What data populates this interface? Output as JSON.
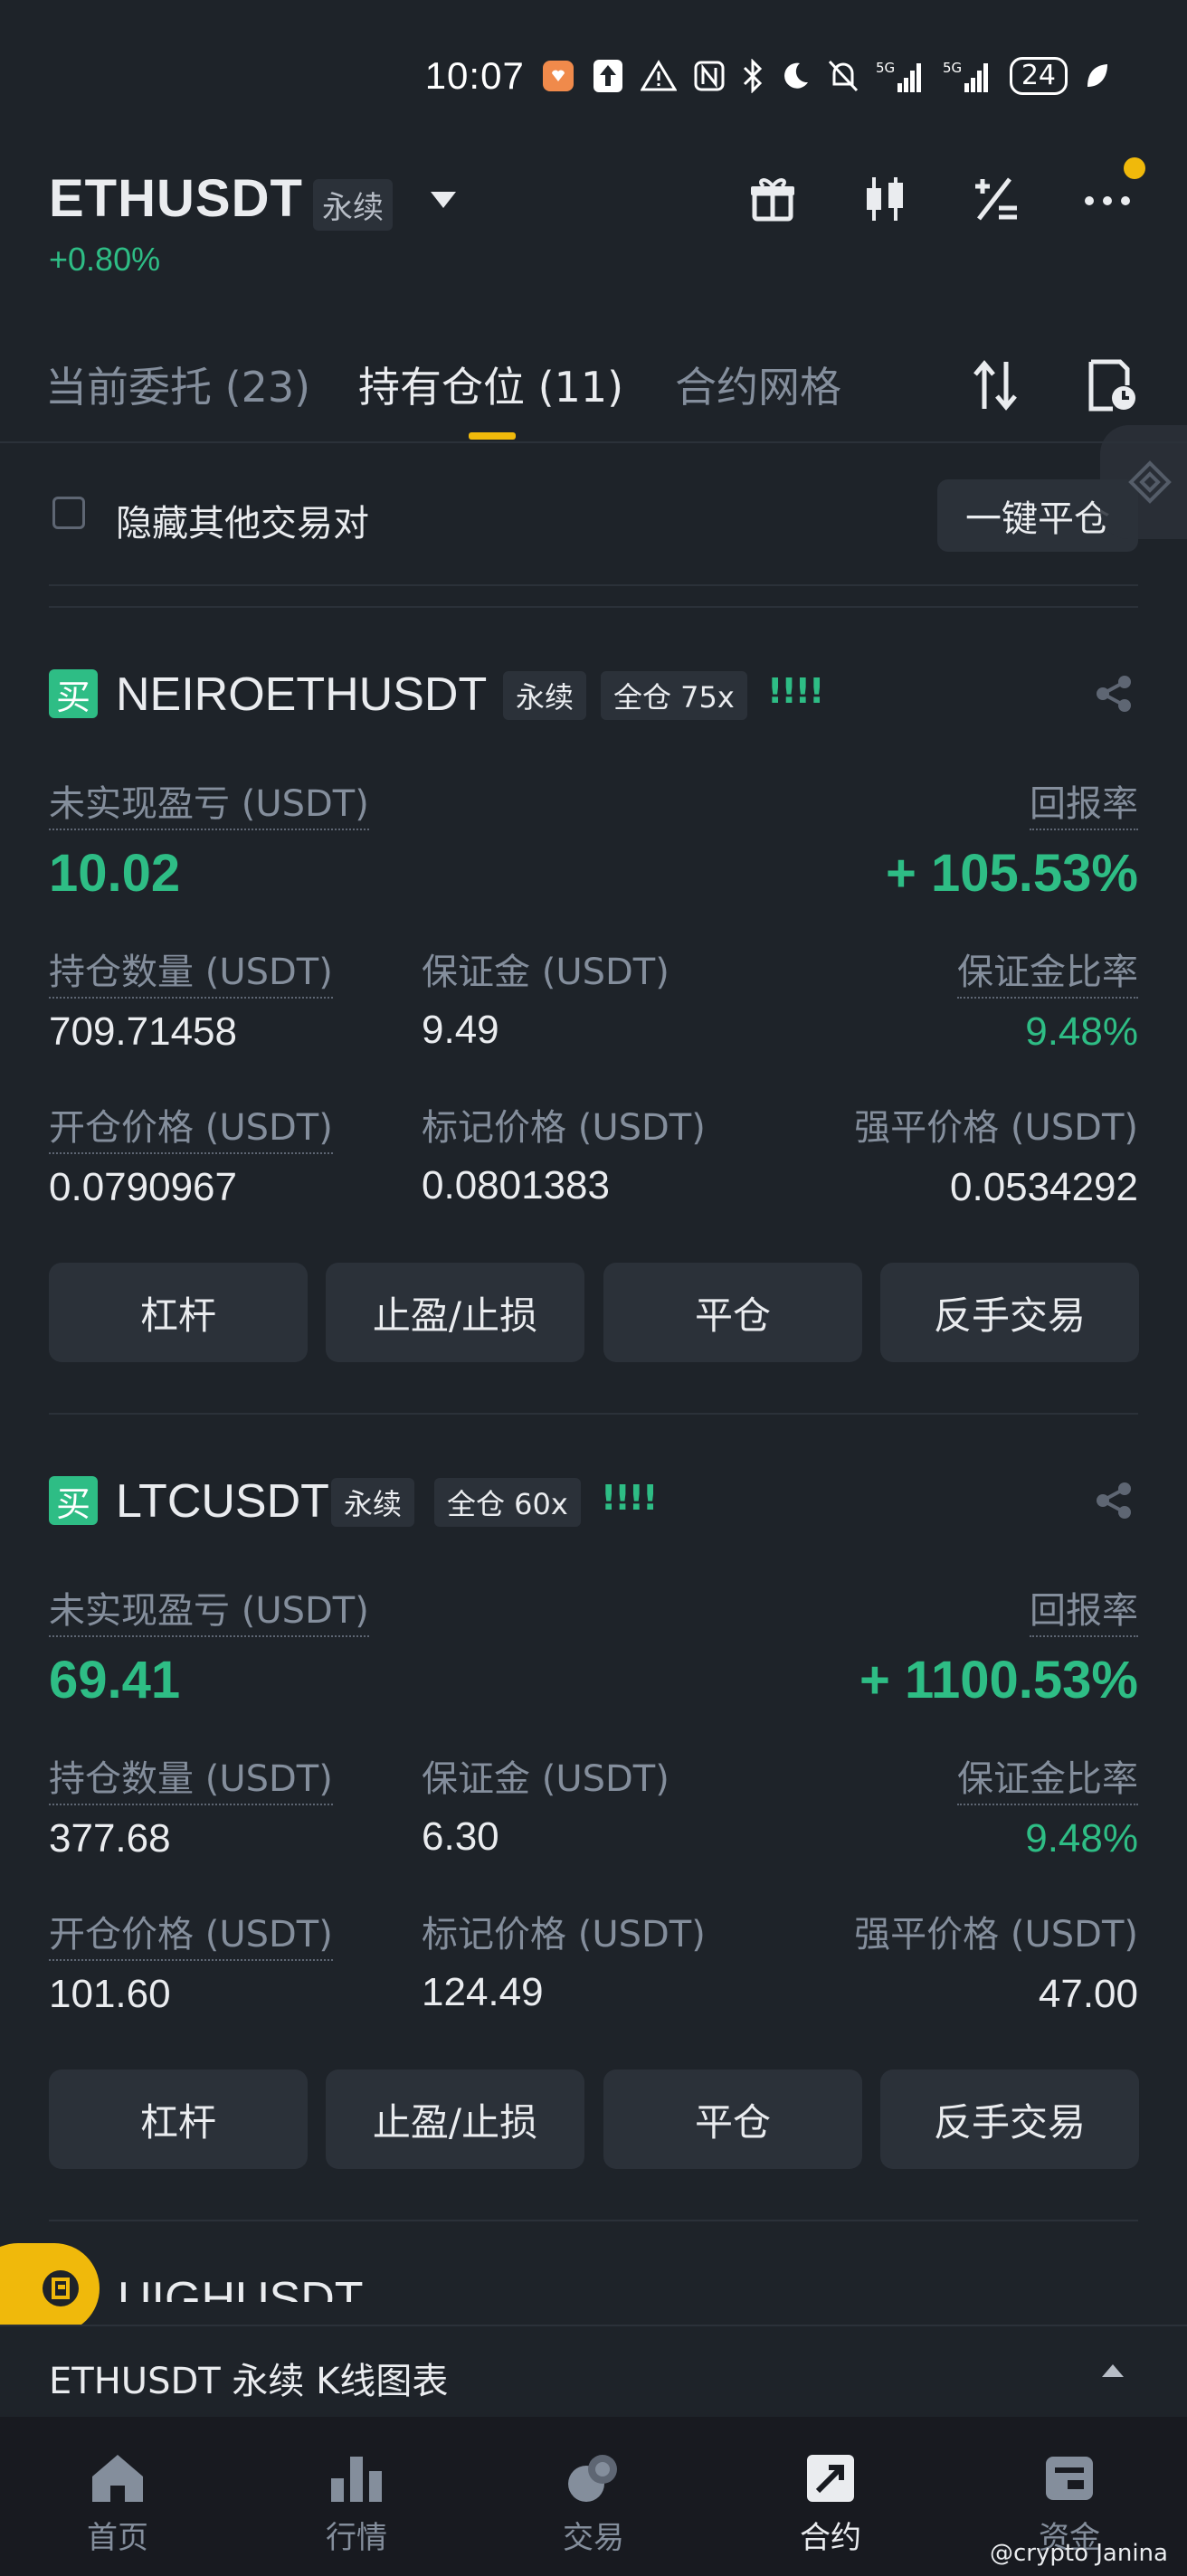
{
  "status_bar": {
    "time": "10:07",
    "battery": "24"
  },
  "header": {
    "symbol": "ETHUSDT",
    "badge": "永续",
    "change": "+0.80%"
  },
  "tabs": [
    {
      "label": "当前委托 (23)"
    },
    {
      "label": "持有仓位 (11)"
    },
    {
      "label": "合约网格"
    }
  ],
  "filter": {
    "hide_others_label": "隐藏其他交易对",
    "close_all_label": "一键平仓"
  },
  "positions": [
    {
      "side": "买",
      "symbol": "NEIROETHUSDT",
      "type": "永续",
      "margin_mode": "全仓 75x",
      "risk": "!!!!",
      "pnl_label": "未实现盈亏 (USDT)",
      "pnl": "10.02",
      "roe_label": "回报率",
      "roe": "+ 105.53%",
      "size_label": "持仓数量 (USDT)",
      "size": "709.71458",
      "margin_label": "保证金 (USDT)",
      "margin": "9.49",
      "margin_ratio_label": "保证金比率",
      "margin_ratio": "9.48%",
      "entry_label": "开仓价格 (USDT)",
      "entry": "0.0790967",
      "mark_label": "标记价格 (USDT)",
      "mark": "0.0801383",
      "liq_label": "强平价格 (USDT)",
      "liq": "0.0534292",
      "buttons": [
        "杠杆",
        "止盈/止损",
        "平仓",
        "反手交易"
      ]
    },
    {
      "side": "买",
      "symbol": "LTCUSDT",
      "type": "永续",
      "margin_mode": "全仓 60x",
      "risk": "!!!!",
      "pnl_label": "未实现盈亏 (USDT)",
      "pnl": "69.41",
      "roe_label": "回报率",
      "roe": "+ 1100.53%",
      "size_label": "持仓数量 (USDT)",
      "size": "377.68",
      "margin_label": "保证金 (USDT)",
      "margin": "6.30",
      "margin_ratio_label": "保证金比率",
      "margin_ratio": "9.48%",
      "entry_label": "开仓价格 (USDT)",
      "entry": "101.60",
      "mark_label": "标记价格 (USDT)",
      "mark": "124.49",
      "liq_label": "强平价格 (USDT)",
      "liq": "47.00",
      "buttons": [
        "杠杆",
        "止盈/止损",
        "平仓",
        "反手交易"
      ]
    }
  ],
  "peek_symbol": "UIGHUSDT",
  "kline_bar": {
    "label": "ETHUSDT 永续 K线图表"
  },
  "bottom_nav": [
    {
      "label": "首页",
      "icon": "home-icon"
    },
    {
      "label": "行情",
      "icon": "markets-icon"
    },
    {
      "label": "交易",
      "icon": "trade-icon"
    },
    {
      "label": "合约",
      "icon": "futures-icon"
    },
    {
      "label": "资金",
      "icon": "wallet-icon"
    }
  ],
  "watermark": "@crypto Janina",
  "colors": {
    "background": "#1e2329",
    "accent": "#f0b90b",
    "positive": "#2ebd85",
    "muted": "#848e9c"
  }
}
